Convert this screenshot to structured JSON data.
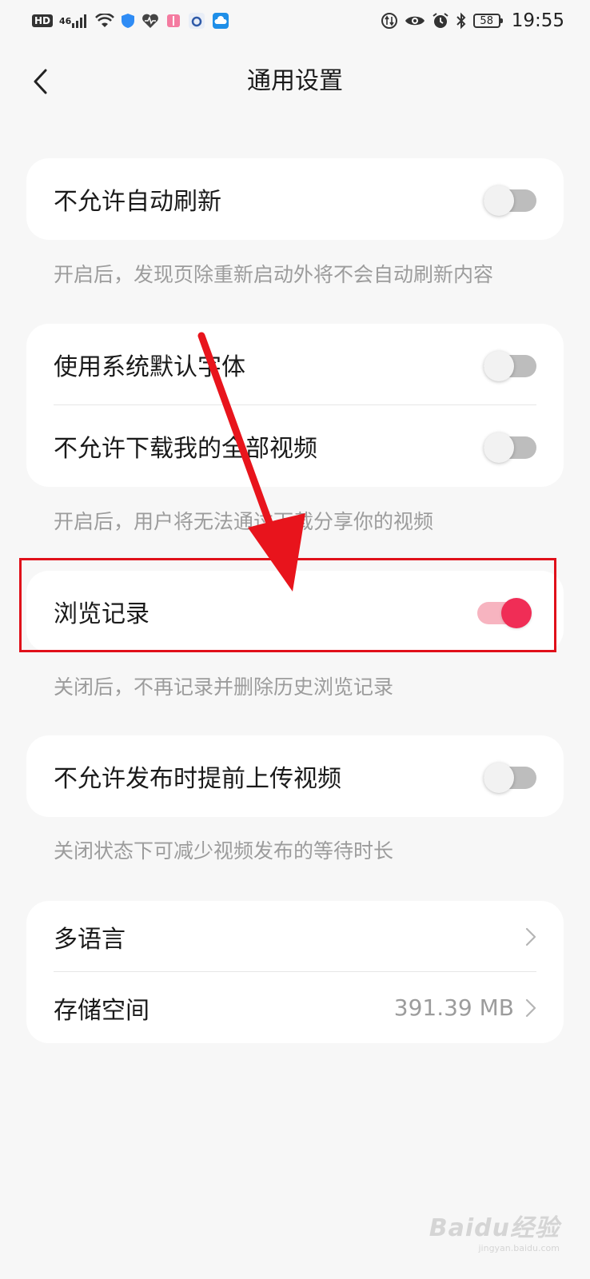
{
  "status_bar": {
    "hd": "HD",
    "network": "46",
    "battery": "58",
    "time": "19:55"
  },
  "header": {
    "title": "通用设置"
  },
  "settings": {
    "group1": {
      "item1": {
        "label": "不允许自动刷新",
        "on": false
      },
      "note": "开启后，发现页除重新启动外将不会自动刷新内容"
    },
    "group2": {
      "item1": {
        "label": "使用系统默认字体",
        "on": false
      },
      "item2": {
        "label": "不允许下载我的全部视频",
        "on": false
      },
      "note": "开启后，用户将无法通过下载分享你的视频"
    },
    "group3": {
      "item1": {
        "label": "浏览记录",
        "on": true
      },
      "note": "关闭后，不再记录并删除历史浏览记录"
    },
    "group4": {
      "item1": {
        "label": "不允许发布时提前上传视频",
        "on": false
      },
      "note": "关闭状态下可减少视频发布的等待时长"
    },
    "group5": {
      "item1": {
        "label": "多语言"
      },
      "item2": {
        "label": "存储空间",
        "value": "391.39 MB"
      }
    }
  },
  "watermark": {
    "main": "Baidu经验",
    "sub": "jingyan.baidu.com"
  },
  "colors": {
    "accent": "#f02d56",
    "annotation": "#e0101a"
  }
}
